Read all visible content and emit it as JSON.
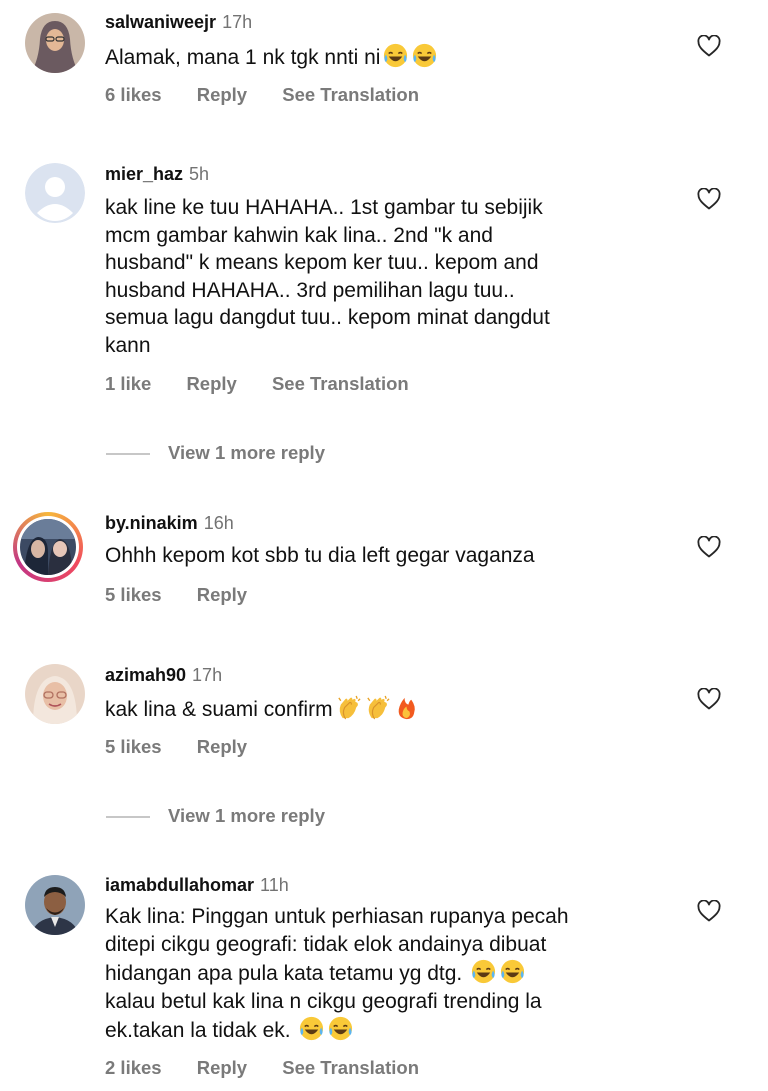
{
  "comments": [
    {
      "username": "salwaniweejr",
      "time": "17h",
      "text": "Alamak, mana 1 nk tgk nnti ni",
      "emojis": [
        "laughing-tears-emoji",
        "laughing-tears-emoji"
      ],
      "likes": "6 likes",
      "reply": "Reply",
      "translate": "See Translation"
    },
    {
      "username": "mier_haz",
      "time": "5h",
      "text": "kak line ke tuu HAHAHA.. 1st gambar tu sebijik\nmcm gambar kahwin kak lina.. 2nd \"k and\nhusband\" k means kepom ker tuu.. kepom and\nhusband HAHAHA.. 3rd pemilihan lagu tuu..\nsemua lagu dangdut tuu.. kepom minat dangdut\nkann",
      "likes": "1 like",
      "reply": "Reply",
      "translate": "See Translation",
      "more_replies": "View 1 more reply"
    },
    {
      "username": "by.ninakim",
      "time": "16h",
      "text": "Ohhh kepom kot sbb tu dia left gegar vaganza",
      "likes": "5 likes",
      "reply": "Reply"
    },
    {
      "username": "azimah90",
      "time": "17h",
      "text": "kak lina & suami confirm",
      "emojis": [
        "clapping-hands-emoji",
        "clapping-hands-emoji",
        "fire-emoji"
      ],
      "likes": "5 likes",
      "reply": "Reply",
      "more_replies": "View 1 more reply"
    },
    {
      "username": "iamabdullahomar",
      "time": "11h",
      "text": "Kak lina: Pinggan untuk perhiasan rupanya pecah\nditepi cikgu geografi: tidak elok andainya dibuat\nhidangan apa pula kata tetamu yg dtg.",
      "text2": "kalau betul kak lina n cikgu geografi trending la\nek.takan la tidak ek.",
      "emojis": [
        "laughing-tears-emoji",
        "laughing-tears-emoji"
      ],
      "likes": "2 likes",
      "reply": "Reply",
      "translate": "See Translation"
    }
  ],
  "icons": {
    "heart": "heart-outline-icon"
  },
  "colors": {
    "secondary_text": "#737373",
    "primary_text": "#111111",
    "story_ring": "#e1306c"
  }
}
